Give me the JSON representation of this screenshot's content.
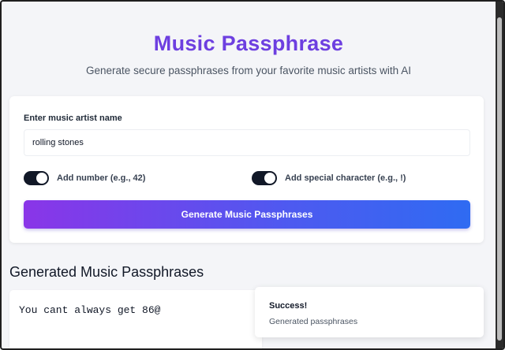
{
  "header": {
    "title": "Music Passphrase",
    "subtitle": "Generate secure passphrases from your favorite music artists with AI"
  },
  "form": {
    "artist_label": "Enter music artist name",
    "artist_value": "rolling stones",
    "add_number": {
      "label": "Add number (e.g., 42)",
      "checked": true
    },
    "add_special": {
      "label": "Add special character (e.g., !)",
      "checked": true
    },
    "generate_label": "Generate Music Passphrases"
  },
  "results": {
    "title": "Generated Music Passphrases",
    "items": [
      "You cant always get 86@"
    ]
  },
  "toast": {
    "title": "Success!",
    "description": "Generated passphrases"
  },
  "colors": {
    "title": "#6d3fe0",
    "button_gradient_start": "#8a35e8",
    "button_gradient_end": "#2f6bf2",
    "toggle_on": "#111827"
  }
}
